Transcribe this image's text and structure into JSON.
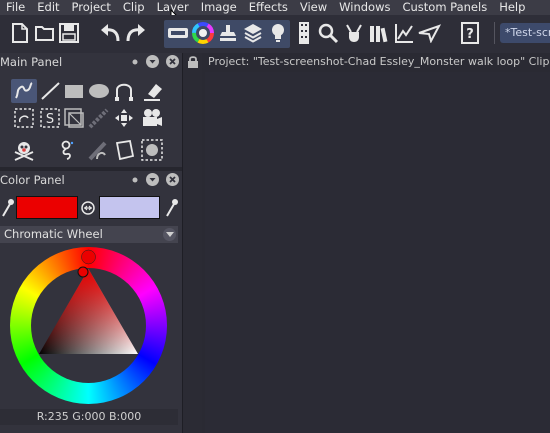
{
  "menu": [
    "File",
    "Edit",
    "Project",
    "Clip",
    "Layer",
    "Image",
    "Effects",
    "View",
    "Windows",
    "Custom Panels",
    "Help"
  ],
  "toolbar": {
    "icons": [
      "new-document-icon",
      "open-folder-icon",
      "save-icon",
      "undo-icon",
      "redo-icon",
      "layer-tool-icon",
      "color-wheel-icon",
      "stamp-icon",
      "layers-stack-icon",
      "lightbulb-icon",
      "film-strip-icon",
      "search-icon",
      "plugin-icon",
      "library-icon",
      "chart-icon",
      "send-icon",
      "help-icon"
    ],
    "document_tab": "*Test-screenshot"
  },
  "main_panel": {
    "title": "Main Panel",
    "tools": [
      "freehand-curve-icon",
      "line-icon",
      "rectangle-icon",
      "ellipse-icon",
      "bezier-icon",
      "eraser-icon",
      "select-icon",
      "text-icon",
      "transform-icon",
      "brush-icon",
      "move-icon",
      "camera-icon",
      "skull-icon",
      "rope-icon",
      "smudge-icon",
      "paper-icon",
      "dotted-select-icon"
    ]
  },
  "color_panel": {
    "title": "Color Panel",
    "primary_color": "#eb0000",
    "secondary_color": "#c4c4ee",
    "mode": "Chromatic Wheel",
    "readout": "R:235 G:000 B:000"
  },
  "project": {
    "label": "Project:  \"Test-screenshot-Chad Essley_Monster walk loop\"  Clip:"
  }
}
